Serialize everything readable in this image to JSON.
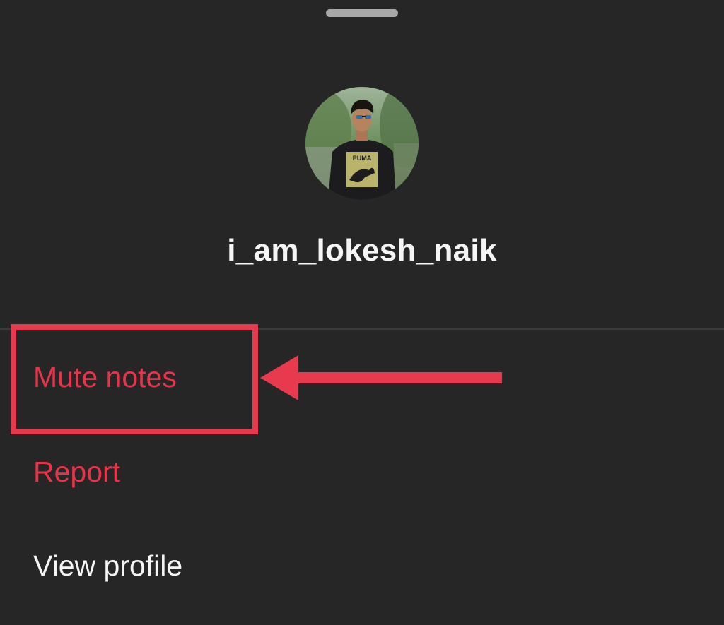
{
  "profile_sheet": {
    "username": "i_am_lokesh_naik",
    "avatar_alt": "profile photo",
    "menu": [
      {
        "id": "mute",
        "label": "Mute notes",
        "color": "#e8334a"
      },
      {
        "id": "report",
        "label": "Report",
        "color": "#e8334a"
      },
      {
        "id": "view_profile",
        "label": "View profile",
        "color": "#f5f5f5"
      }
    ]
  },
  "annotation": {
    "color": "#e83a4f"
  },
  "theme": {
    "background": "#262626",
    "handle": "#a8a8a8",
    "divider": "#3a3a3a"
  }
}
